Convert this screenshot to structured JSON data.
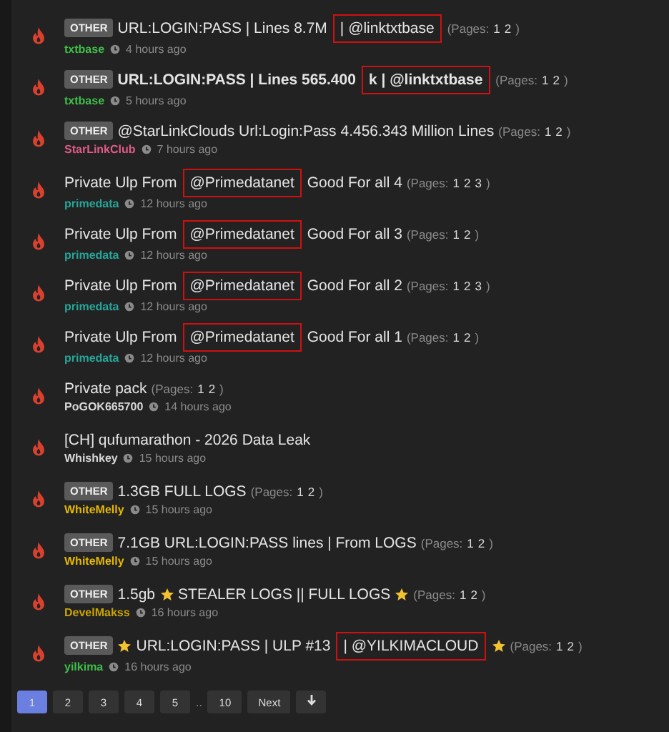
{
  "threads": [
    {
      "tag": "OTHER",
      "bold": false,
      "segments": [
        {
          "kind": "text",
          "text": "URL:LOGIN:PASS | Lines 8.7M",
          "highlighted": false
        },
        {
          "kind": "text",
          "text": "| @linktxtbase",
          "highlighted": true
        }
      ],
      "pages_label": "(Pages:",
      "pages": [
        "1",
        "2"
      ],
      "pages_end": ")",
      "author": "txtbase",
      "color": "#3fbf4a",
      "time": "4 hours ago"
    },
    {
      "tag": "OTHER",
      "bold": true,
      "segments": [
        {
          "kind": "text",
          "text": "URL:LOGIN:PASS | Lines 565.400",
          "highlighted": false
        },
        {
          "kind": "text",
          "text": "k | @linktxtbase",
          "highlighted": true
        }
      ],
      "pages_label": "(Pages:",
      "pages": [
        "1",
        "2"
      ],
      "pages_end": ")",
      "author": "txtbase",
      "color": "#3fbf4a",
      "time": "5 hours ago"
    },
    {
      "tag": "OTHER",
      "bold": false,
      "segments": [
        {
          "kind": "text",
          "text": "@StarLinkClouds Url:Login:Pass 4.456.343 Million Lines",
          "highlighted": false
        }
      ],
      "pages_label": "(Pages:",
      "pages": [
        "1",
        "2"
      ],
      "pages_end": ")",
      "author": "StarLinkClub",
      "color": "#e05a8a",
      "time": "7 hours ago"
    },
    {
      "bold": false,
      "segments": [
        {
          "kind": "text",
          "text": "Private Ulp From",
          "highlighted": false
        },
        {
          "kind": "text",
          "text": "@Primedatanet",
          "highlighted": true
        },
        {
          "kind": "text",
          "text": "Good For all 4",
          "highlighted": false
        }
      ],
      "pages_label": "(Pages:",
      "pages": [
        "1",
        "2",
        "3"
      ],
      "pages_end": ")",
      "author": "primedata",
      "color": "#26a69a",
      "time": "12 hours ago"
    },
    {
      "bold": false,
      "segments": [
        {
          "kind": "text",
          "text": "Private Ulp From",
          "highlighted": false
        },
        {
          "kind": "text",
          "text": "@Primedatanet",
          "highlighted": true
        },
        {
          "kind": "text",
          "text": "Good For all 3",
          "highlighted": false
        }
      ],
      "pages_label": "(Pages:",
      "pages": [
        "1",
        "2"
      ],
      "pages_end": ")",
      "author": "primedata",
      "color": "#26a69a",
      "time": "12 hours ago"
    },
    {
      "bold": false,
      "segments": [
        {
          "kind": "text",
          "text": "Private Ulp From",
          "highlighted": false
        },
        {
          "kind": "text",
          "text": "@Primedatanet",
          "highlighted": true
        },
        {
          "kind": "text",
          "text": "Good For all 2",
          "highlighted": false
        }
      ],
      "pages_label": "(Pages:",
      "pages": [
        "1",
        "2",
        "3"
      ],
      "pages_end": ")",
      "author": "primedata",
      "color": "#26a69a",
      "time": "12 hours ago"
    },
    {
      "bold": false,
      "segments": [
        {
          "kind": "text",
          "text": "Private Ulp From",
          "highlighted": false
        },
        {
          "kind": "text",
          "text": "@Primedatanet",
          "highlighted": true
        },
        {
          "kind": "text",
          "text": "Good For all 1",
          "highlighted": false
        }
      ],
      "pages_label": "(Pages:",
      "pages": [
        "1",
        "2"
      ],
      "pages_end": ")",
      "author": "primedata",
      "color": "#26a69a",
      "time": "12 hours ago"
    },
    {
      "bold": false,
      "segments": [
        {
          "kind": "text",
          "text": "Private pack",
          "highlighted": false
        }
      ],
      "pages_label": "(Pages:",
      "pages": [
        "1",
        "2"
      ],
      "pages_end": ")",
      "author": "PoGOK665700",
      "color": "#d8d8d8",
      "time": "14 hours ago"
    },
    {
      "bold": false,
      "segments": [
        {
          "kind": "text",
          "text": "[CH] qufumarathon - 2026 Data Leak",
          "highlighted": false
        }
      ],
      "author": "Whishkey",
      "color": "#d8d8d8",
      "time": "15 hours ago"
    },
    {
      "tag": "OTHER",
      "bold": false,
      "segments": [
        {
          "kind": "text",
          "text": "1.3GB FULL LOGS",
          "highlighted": false
        }
      ],
      "pages_label": "(Pages:",
      "pages": [
        "1",
        "2"
      ],
      "pages_end": ")",
      "author": "WhiteMelly",
      "color": "#e6b800",
      "time": "15 hours ago"
    },
    {
      "tag": "OTHER",
      "bold": false,
      "segments": [
        {
          "kind": "text",
          "text": "7.1GB URL:LOGIN:PASS lines | From LOGS",
          "highlighted": false
        }
      ],
      "pages_label": "(Pages:",
      "pages": [
        "1",
        "2"
      ],
      "pages_end": ")",
      "author": "WhiteMelly",
      "color": "#e6b800",
      "time": "15 hours ago"
    },
    {
      "tag": "OTHER",
      "bold": false,
      "segments": [
        {
          "kind": "text",
          "text": "1.5gb",
          "highlighted": false
        },
        {
          "kind": "star"
        },
        {
          "kind": "text",
          "text": "STEALER LOGS || FULL LOGS",
          "highlighted": false
        },
        {
          "kind": "star"
        }
      ],
      "pages_label": "(Pages:",
      "pages": [
        "1",
        "2"
      ],
      "pages_end": ")",
      "author": "DevelMakss",
      "color": "#c9a400",
      "time": "16 hours ago"
    },
    {
      "tag": "OTHER",
      "bold": false,
      "segments": [
        {
          "kind": "star"
        },
        {
          "kind": "text",
          "text": "URL:LOGIN:PASS | ULP #13",
          "highlighted": false
        },
        {
          "kind": "text",
          "text": "| @YILKIMACLOUD",
          "highlighted": true
        },
        {
          "kind": "star"
        }
      ],
      "pages_label": "(Pages:",
      "pages": [
        "1",
        "2"
      ],
      "pages_end": ")",
      "author": "yilkima",
      "color": "#3fbf4a",
      "time": "16 hours ago"
    }
  ],
  "pagination": {
    "pages": [
      {
        "label": "1",
        "selected": true
      },
      {
        "label": "2",
        "selected": false
      },
      {
        "label": "3",
        "selected": false
      },
      {
        "label": "4",
        "selected": false
      },
      {
        "label": "5",
        "selected": false
      }
    ],
    "ellipsis": "..",
    "last": "10",
    "next": "Next"
  }
}
